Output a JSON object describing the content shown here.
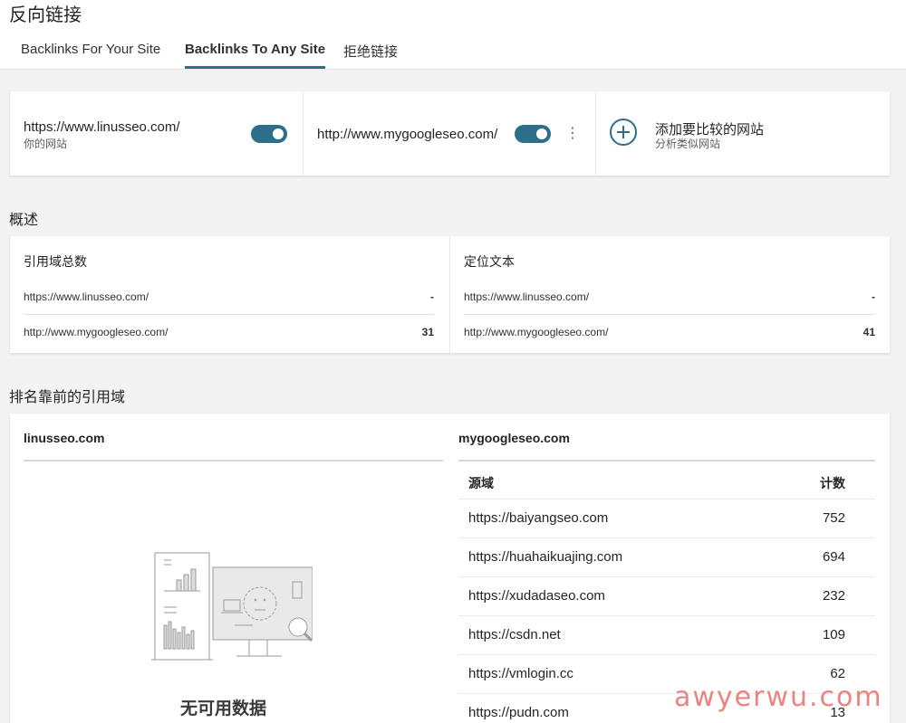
{
  "header": {
    "title": "反向链接",
    "tabs": [
      {
        "label": "Backlinks For Your Site",
        "active": false
      },
      {
        "label": "Backlinks To Any Site",
        "active": true
      },
      {
        "label": "拒绝链接",
        "active": false
      }
    ]
  },
  "sites": {
    "primary": {
      "url": "https://www.linusseo.com/",
      "subtitle": "你的网站",
      "enabled": true
    },
    "compare": {
      "url": "http://www.mygoogleseo.com/",
      "enabled": true,
      "menu_glyph": "⋮"
    },
    "add": {
      "label": "添加要比较的网站",
      "subtitle": "分析类似网站"
    }
  },
  "overview": {
    "title": "概述",
    "referring_domains": {
      "heading": "引用域总数",
      "rows": [
        {
          "site": "https://www.linusseo.com/",
          "value": "-"
        },
        {
          "site": "http://www.mygoogleseo.com/",
          "value": "31"
        }
      ]
    },
    "anchor_text": {
      "heading": "定位文本",
      "rows": [
        {
          "site": "https://www.linusseo.com/",
          "value": "-"
        },
        {
          "site": "http://www.mygoogleseo.com/",
          "value": "41"
        }
      ]
    }
  },
  "top_domains": {
    "title": "排名靠前的引用域",
    "left": {
      "site": "linusseo.com",
      "empty_text": "无可用数据"
    },
    "right": {
      "site": "mygoogleseo.com",
      "columns": {
        "domain": "源域",
        "count": "计数"
      },
      "rows": [
        {
          "domain": "https://baiyangseo.com",
          "count": "752"
        },
        {
          "domain": "https://huahaikuajing.com",
          "count": "694"
        },
        {
          "domain": "https://xudadaseo.com",
          "count": "232"
        },
        {
          "domain": "https://csdn.net",
          "count": "109"
        },
        {
          "domain": "https://vmlogin.cc",
          "count": "62"
        },
        {
          "domain": "https://pudn.com",
          "count": "13"
        }
      ]
    }
  },
  "watermark": "awyerwu.com",
  "colors": {
    "accent": "#2b6f88",
    "watermark": "#e86e69"
  }
}
